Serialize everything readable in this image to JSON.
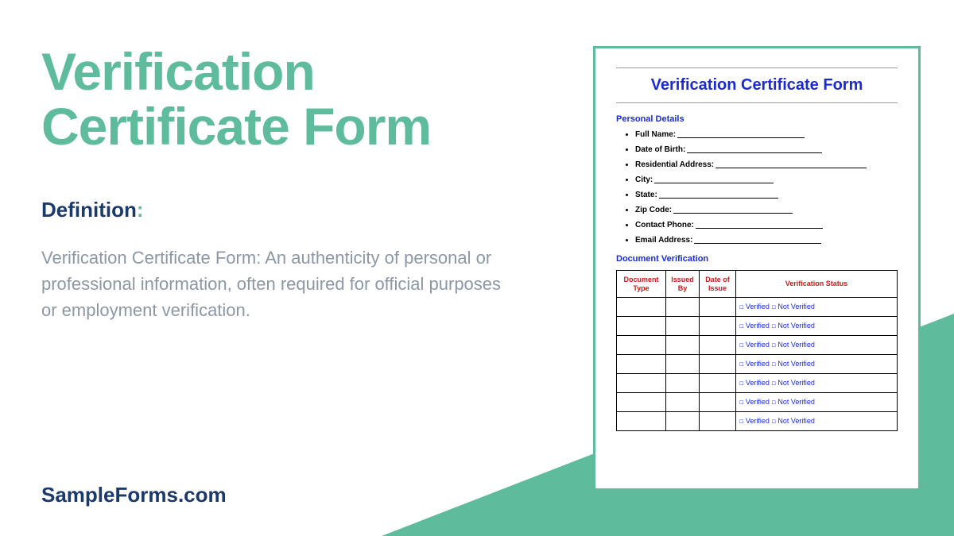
{
  "main": {
    "title": "Verification Certificate Form",
    "definition_label": "Definition",
    "definition_colon": ":",
    "definition_body": "Verification Certificate Form: An authenticity of personal or professional information, often required for official purposes or employment verification."
  },
  "site": "SampleForms.com",
  "form": {
    "title": "Verification Certificate Form",
    "section_personal": "Personal Details",
    "section_docver": "Document Verification",
    "fields": [
      "Full Name:",
      "Date of Birth:",
      "Residential Address:",
      "City:",
      "State:",
      "Zip Code:",
      "Contact Phone:",
      "Email Address:"
    ],
    "table_headers": [
      "Document Type",
      "Issued By",
      "Date of Issue",
      "Verification Status"
    ],
    "status_verified": "Verified",
    "status_not_verified": "Not Verified",
    "checkbox_glyph": "☐",
    "row_count": 7
  }
}
